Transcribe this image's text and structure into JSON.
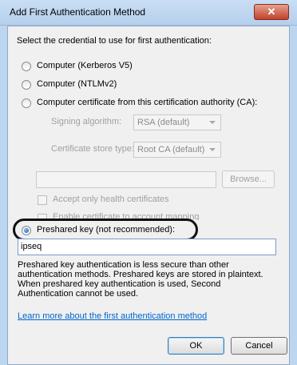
{
  "window": {
    "title": "Add First Authentication Method",
    "close_label": "✕"
  },
  "instruction": "Select the credential to use for first authentication:",
  "options": {
    "kerberos": "Computer (Kerberos V5)",
    "ntlm": "Computer (NTLMv2)",
    "certificate": "Computer certificate from this certification authority (CA):",
    "preshared": "Preshared key (not recommended):"
  },
  "certificate": {
    "signing_label": "Signing algorithm:",
    "signing_value": "RSA (default)",
    "store_label": "Certificate store type:",
    "store_value": "Root CA (default)",
    "browse_label": "Browse...",
    "health_label": "Accept only health certificates",
    "mapping_label": "Enable certificate to account mapping"
  },
  "preshared": {
    "value": "ipseq",
    "warning": [
      "Preshared key authentication is less secure than other",
      "authentication methods. Preshared keys are stored in plaintext.",
      "When preshared key authentication is used, Second",
      "Authentication cannot be used."
    ]
  },
  "learn_more_link": "Learn more about the first authentication method",
  "buttons": {
    "ok": "OK",
    "cancel": "Cancel"
  },
  "selected_option": "preshared"
}
